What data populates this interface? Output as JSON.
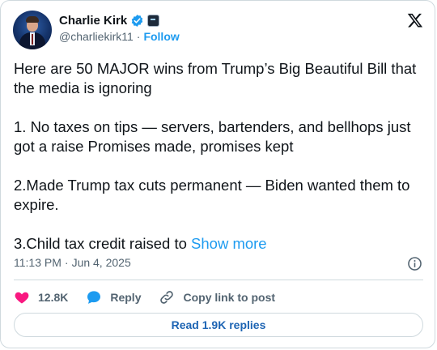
{
  "author": {
    "name": "Charlie Kirk",
    "handle": "@charliekirk11",
    "separator": "·",
    "follow_label": "Follow"
  },
  "tweet": {
    "paragraphs": [
      "Here are 50 MAJOR wins from Trump’s Big Beautiful Bill that the media is ignoring",
      "1. No taxes on tips — servers, bartenders, and bellhops just got a raise Promises made, promises kept",
      "2.Made Trump tax cuts permanent — Biden wanted them to expire.",
      "3.Child tax credit raised to"
    ],
    "show_more_label": "Show more",
    "time": "11:13 PM",
    "date_separator": "·",
    "date": "Jun 4, 2025"
  },
  "actions": {
    "likes_count": "12.8K",
    "reply_label": "Reply",
    "copy_link_label": "Copy link to post",
    "read_replies_label": "Read 1.9K replies"
  },
  "colors": {
    "accent": "#1d9bf0",
    "like": "#f91880",
    "text": "#0f1419",
    "muted": "#536471",
    "border": "#cfd9de"
  },
  "icons": {
    "verified": "verified-badge-icon",
    "affiliation": "affiliation-badge-icon",
    "logo": "x-logo-icon",
    "info": "info-icon",
    "like": "heart-icon",
    "reply": "speech-bubble-icon",
    "copy_link": "link-icon"
  }
}
